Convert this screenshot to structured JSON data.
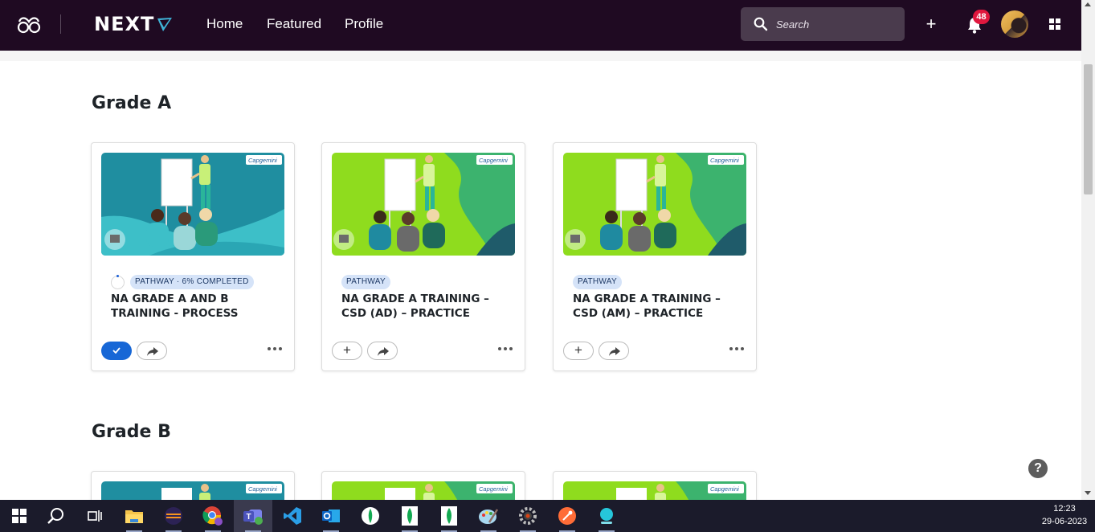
{
  "nav": {
    "brand": "NEXT",
    "links": [
      "Home",
      "Featured",
      "Profile"
    ],
    "search_placeholder": "Search",
    "notification_count": "48",
    "icons": [
      "glasses-logo-icon",
      "plus-icon",
      "bell-icon",
      "avatar",
      "apps-grid-icon"
    ]
  },
  "sections": [
    {
      "title": "Grade A",
      "cards": [
        {
          "tag": "PATHWAY · 6% COMPLETED",
          "title": "NA GRADE A AND B TRAINING - PROCESS",
          "progress": 0.06,
          "enrolled": true,
          "thumb_theme": "teal",
          "thumb_logo": "Capgemini"
        },
        {
          "tag": "PATHWAY",
          "title": "NA GRADE A TRAINING – CSD (AD) – PRACTICE",
          "enrolled": false,
          "thumb_theme": "green",
          "thumb_logo": "Capgemini"
        },
        {
          "tag": "PATHWAY",
          "title": "NA GRADE A TRAINING – CSD (AM) – PRACTICE",
          "enrolled": false,
          "thumb_theme": "green",
          "thumb_logo": "Capgemini"
        }
      ]
    },
    {
      "title": "Grade B",
      "cards": [
        {
          "thumb_theme": "teal",
          "thumb_logo": "Capgemini"
        },
        {
          "thumb_theme": "green",
          "thumb_logo": "Capgemini"
        },
        {
          "thumb_theme": "green",
          "thumb_logo": "Capgemini"
        }
      ]
    }
  ],
  "help_label": "?",
  "taskbar": {
    "apps": [
      "windows-start-icon",
      "search-icon",
      "task-view-icon",
      "file-explorer-icon",
      "eclipse-icon",
      "chrome-icon",
      "teams-icon",
      "vscode-icon",
      "outlook-icon",
      "mongodb-compass-icon",
      "mongodb-icon",
      "mongodb-atlas-icon",
      "paint-icon",
      "settings-icon",
      "postman-icon",
      "app-icon"
    ],
    "time": "12:23",
    "date": "29-06-2023"
  },
  "colors": {
    "nav_bg": "#1f0a22",
    "accent_blue": "#1767d6",
    "tag_bg": "#d5e3f8",
    "badge_red": "#e0173e",
    "thumb_teal": "#1f8ea0",
    "thumb_green": "#8fdc1e"
  }
}
